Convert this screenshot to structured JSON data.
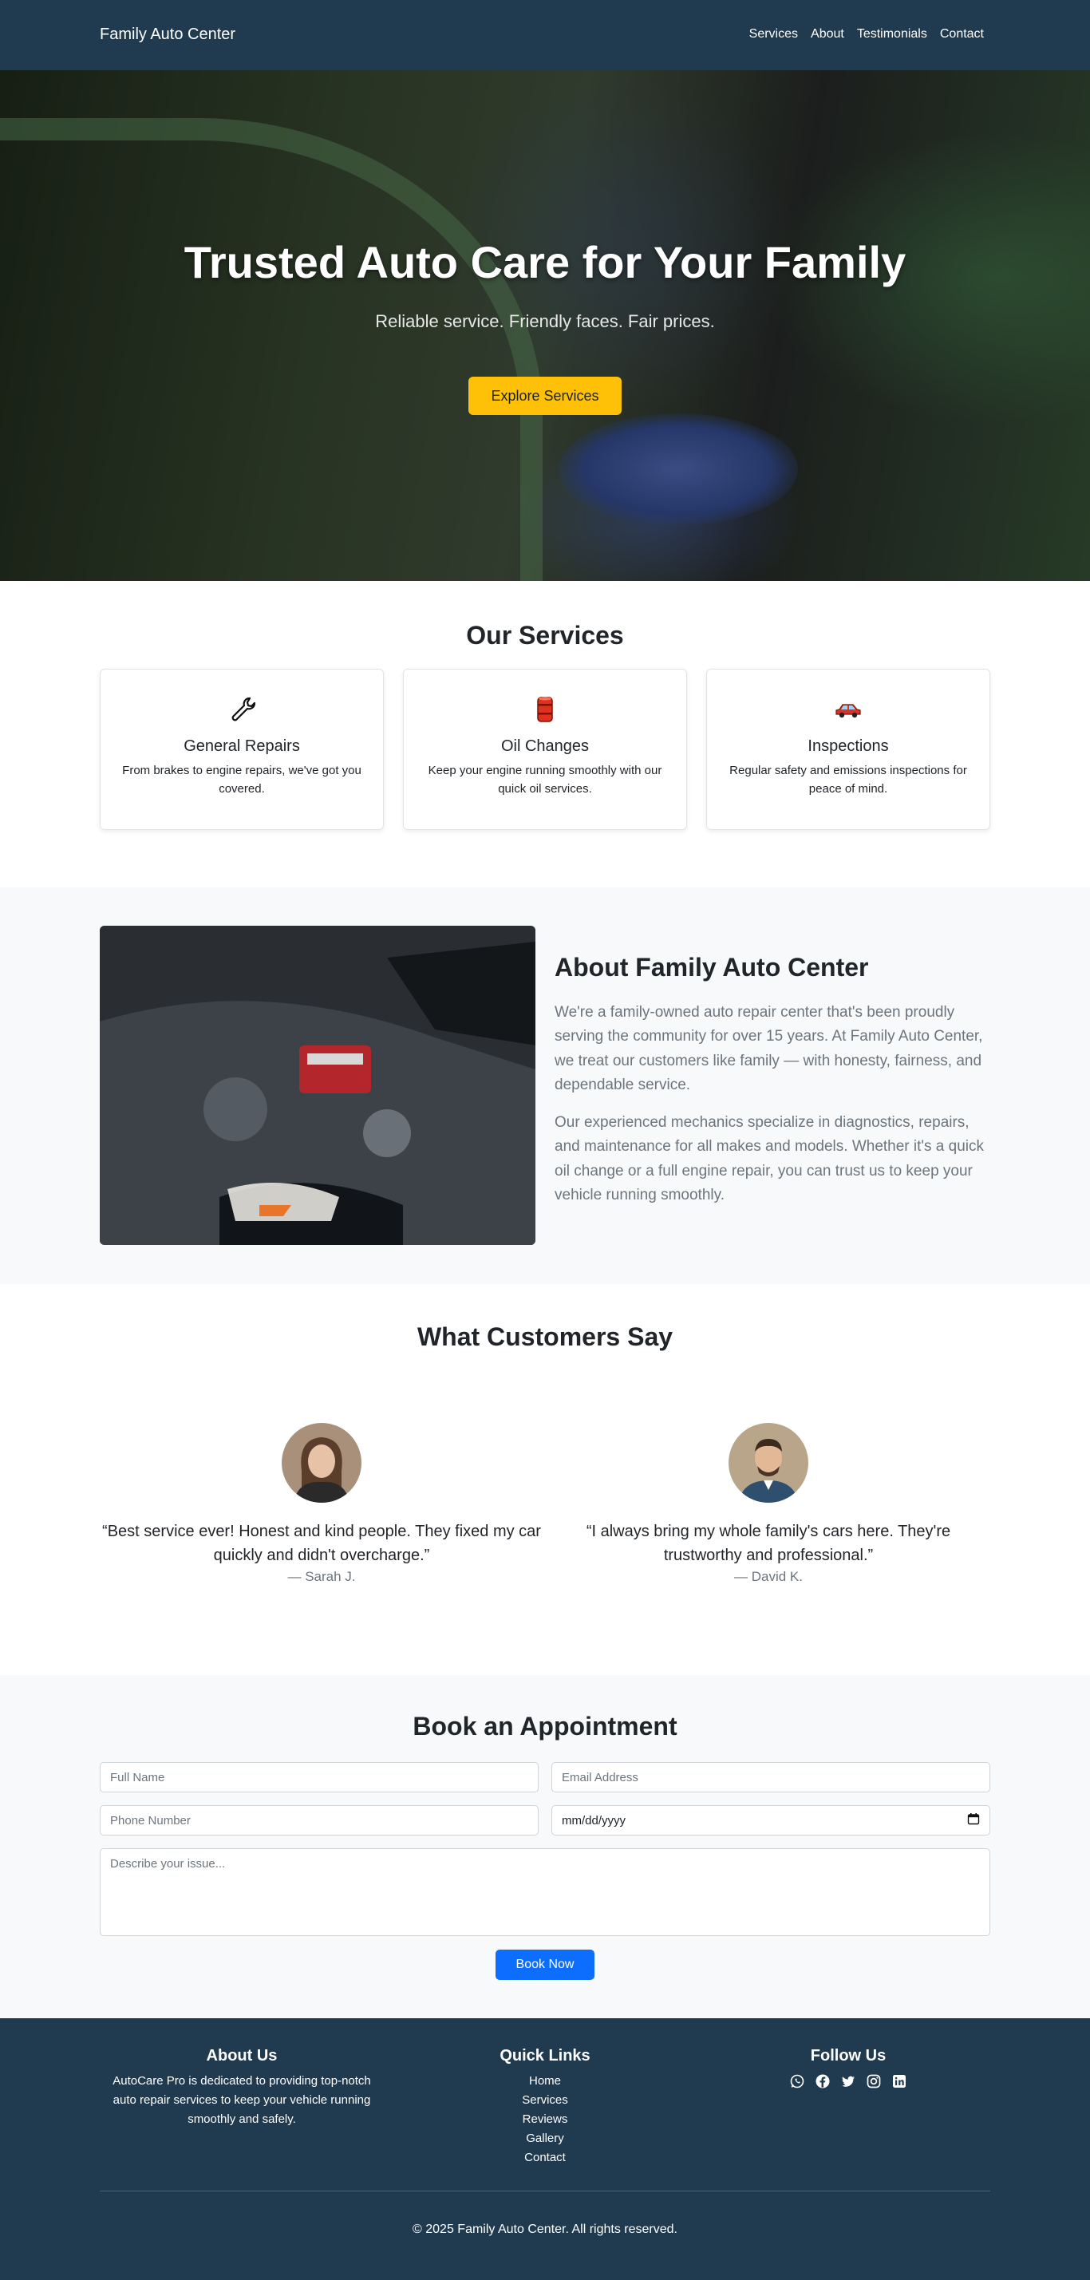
{
  "nav": {
    "brand": "Family Auto Center",
    "links": [
      "Services",
      "About",
      "Testimonials",
      "Contact"
    ]
  },
  "hero": {
    "title": "Trusted Auto Care for Your Family",
    "subtitle": "Reliable service. Friendly faces. Fair prices.",
    "cta_label": "Explore Services"
  },
  "services": {
    "title": "Our Services",
    "items": [
      {
        "icon": "wrench-icon",
        "title": "General Repairs",
        "text": "From brakes to engine repairs, we've got you covered."
      },
      {
        "icon": "oil-drum-icon",
        "title": "Oil Changes",
        "text": "Keep your engine running smoothly with our quick oil services."
      },
      {
        "icon": "car-icon",
        "title": "Inspections",
        "text": "Regular safety and emissions inspections for peace of mind."
      }
    ]
  },
  "about": {
    "title": "About Family Auto Center",
    "p1": "We're a family-owned auto repair center that's been proudly serving the community for over 15 years. At Family Auto Center, we treat our customers like family — with honesty, fairness, and dependable service.",
    "p2": "Our experienced mechanics specialize in diagnostics, repairs, and maintenance for all makes and models. Whether it's a quick oil change or a full engine repair, you can trust us to keep your vehicle running smoothly."
  },
  "testimonials": {
    "title": "What Customers Say",
    "items": [
      {
        "quote": "“Best service ever! Honest and kind people. They fixed my car quickly and didn't overcharge.”",
        "author": "— Sarah J."
      },
      {
        "quote": "“I always bring my whole family's cars here. They're trustworthy and professional.”",
        "author": "— David K."
      }
    ]
  },
  "booking": {
    "title": "Book an Appointment",
    "name_placeholder": "Full Name",
    "email_placeholder": "Email Address",
    "phone_placeholder": "Phone Number",
    "date_placeholder": "mm/dd/yyyy",
    "issue_placeholder": "Describe your issue...",
    "submit_label": "Book Now"
  },
  "footer": {
    "about_heading": "About Us",
    "about_text": "AutoCare Pro is dedicated to providing top-notch auto repair services to keep your vehicle running smoothly and safely.",
    "links_heading": "Quick Links",
    "links": [
      "Home",
      "Services",
      "Reviews",
      "Gallery",
      "Contact"
    ],
    "social_heading": "Follow Us",
    "social_icons": [
      "whatsapp-icon",
      "facebook-icon",
      "twitter-icon",
      "instagram-icon",
      "linkedin-icon"
    ],
    "copyright": "© 2025 Family Auto Center. All rights reserved."
  },
  "colors": {
    "navbar": "#203a4f",
    "accent_yellow": "#ffc107",
    "primary_blue": "#0d6efd",
    "section_gray": "#f8f9fa"
  }
}
